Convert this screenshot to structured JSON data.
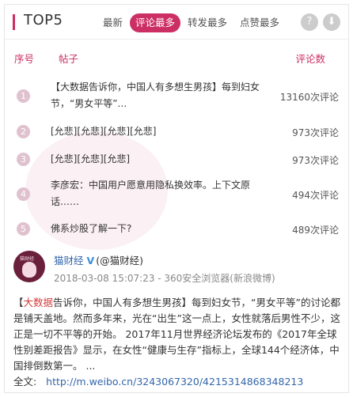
{
  "header": {
    "title": "TOP5",
    "tabs": [
      {
        "label": "最新",
        "active": false
      },
      {
        "label": "评论最多",
        "active": true
      },
      {
        "label": "转发最多",
        "active": false
      },
      {
        "label": "点赞最多",
        "active": false
      }
    ],
    "help_glyph": "?",
    "download_glyph": "⬇"
  },
  "columns": {
    "index": "序号",
    "post": "帖子",
    "comments": "评论数"
  },
  "rows": [
    {
      "num": "1",
      "title": "【大数据告诉你，中国人有多想生男孩】每到妇女节，“男女平等”…",
      "count": "13160次评论"
    },
    {
      "num": "2",
      "title": "[允悲][允悲][允悲][允悲]",
      "count": "973次评论"
    },
    {
      "num": "3",
      "title": "[允悲][允悲][允悲]",
      "count": "973次评论"
    },
    {
      "num": "4",
      "title": "李彦宏：中国用户愿意用隐私换效率。上下文原话……",
      "count": "494次评论"
    },
    {
      "num": "5",
      "title": "佛系炒股了解一下?",
      "count": "489次评论"
    }
  ],
  "post": {
    "avatar_caption": "猫财经",
    "username": "猫财经",
    "verified_glyph": "V",
    "handle": "(@猫财经)",
    "meta": "2018-03-08 15:07:23 - 360安全浏览器(新浪微博)",
    "content": {
      "bracket_open": "【",
      "keyword": "大数据",
      "body": "告诉你，中国人有多想生男孩】每到妇女节，“男女平等”的讨论都是铺天盖地。然而多年来，光在“出生”这一点上，女性就落后男性不少，这正是一切不平等的开始。 2017年11月世界经济论坛发布的《2017年全球性别差距报告》显示，在女性“健康与生存”指标上，全球144个经济体，中国排倒数第一。 ...",
      "fulltext_label": "全文:",
      "link": "http://m.weibo.cn/3243067320/4215314868348213"
    }
  },
  "colors": {
    "accent": "#cc2f63",
    "number_badge": "#e0c2cf",
    "link": "#3366aa",
    "highlight": "#d63b3b"
  }
}
